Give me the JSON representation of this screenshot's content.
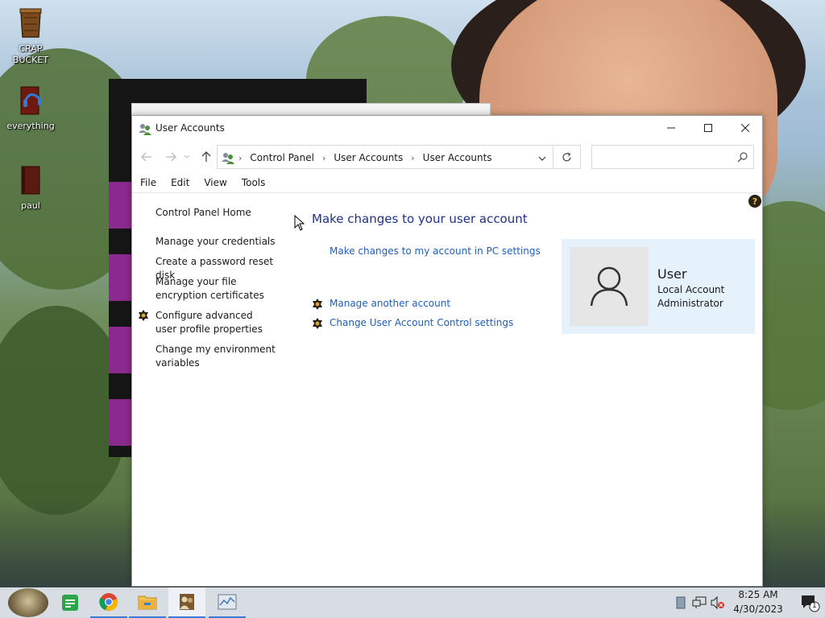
{
  "desktop": {
    "icons": [
      {
        "label": "CRAP BUCKET",
        "icon": "bucket-icon"
      },
      {
        "label": "everything",
        "icon": "headphones-book-icon"
      },
      {
        "label": "paul",
        "icon": "book-icon"
      }
    ]
  },
  "window": {
    "title": "User Accounts",
    "icon": "user-accounts-icon",
    "controls": {
      "minimize": "minimize-icon",
      "maximize": "maximize-icon",
      "close": "close-icon"
    }
  },
  "navigation": {
    "breadcrumbs": [
      "Control Panel",
      "User Accounts",
      "User Accounts"
    ],
    "search_placeholder": ""
  },
  "menubar": [
    "File",
    "Edit",
    "View",
    "Tools"
  ],
  "left_pane": {
    "home": "Control Panel Home",
    "links": [
      {
        "label": "Manage your credentials"
      },
      {
        "label": "Create a password reset disk"
      },
      {
        "label": "Manage your file encryption certificates"
      },
      {
        "label": "Configure advanced user profile properties",
        "shield": true
      },
      {
        "label": "Change my environment variables"
      }
    ]
  },
  "content": {
    "heading": "Make changes to your user account",
    "pc_settings_link": "Make changes to my account in PC settings",
    "actions": [
      {
        "label": "Manage another account",
        "shield": true
      },
      {
        "label": "Change User Account Control settings",
        "shield": true
      }
    ]
  },
  "user": {
    "name": "User",
    "account_type": "Local Account",
    "role": "Administrator"
  },
  "taskbar": {
    "apps": [
      "start-icon",
      "notes-icon",
      "chrome-icon",
      "file-explorer-icon",
      "user-accounts-icon",
      "resource-monitor-icon"
    ],
    "tray": {
      "time": "8:25 AM",
      "date": "4/30/2023",
      "notification_count": "1"
    }
  },
  "colors": {
    "heading": "#1e3287",
    "link": "#1f5fb8",
    "user_tile_bg": "#e5f1fb",
    "taskbar": "#d8dde3"
  }
}
